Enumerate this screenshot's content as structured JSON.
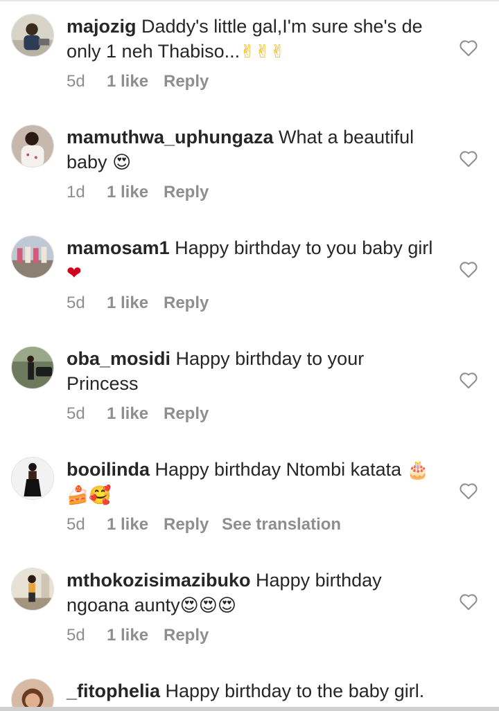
{
  "comments": [
    {
      "username": "majozig",
      "text": "Daddy's little gal,I'm sure she's de only 1 neh Thabiso...",
      "emoji": "✌✌✌",
      "time": "5d",
      "likes": "1 like",
      "reply": "Reply"
    },
    {
      "username": "mamuthwa_uphungaza",
      "text": "What a beautiful baby",
      "emoji": "😍",
      "time": "1d",
      "likes": "1 like",
      "reply": "Reply"
    },
    {
      "username": "mamosam1",
      "text": "Happy birthday to you baby girl",
      "emoji": "❤",
      "time": "5d",
      "likes": "1 like",
      "reply": "Reply"
    },
    {
      "username": "oba_mosidi",
      "text": "Happy birthday to your Princess",
      "emoji": "",
      "time": "5d",
      "likes": "1 like",
      "reply": "Reply"
    },
    {
      "username": "booilinda",
      "text": "Happy birthday Ntombi katata",
      "emoji": "🎂🍰🥰",
      "time": "5d",
      "likes": "1 like",
      "reply": "Reply",
      "see_translation": "See translation"
    },
    {
      "username": "mthokozisimazibuko",
      "text": "Happy birthday ngoana aunty",
      "emoji": "😍😍😍",
      "time": "5d",
      "likes": "1 like",
      "reply": "Reply"
    },
    {
      "username": "_fitophelia",
      "text": "Happy birthday to the baby girl.",
      "emoji": "",
      "time": "",
      "likes": "",
      "reply": ""
    }
  ],
  "colors": {
    "text": "#262626",
    "meta": "#8e8e8e",
    "heart_outline": "#8e8e8e",
    "background": "#ffffff"
  },
  "icons": {
    "like": "heart-outline-icon"
  }
}
